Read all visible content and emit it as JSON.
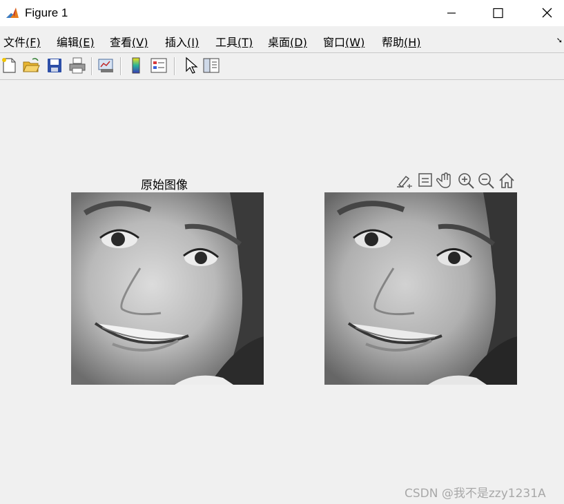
{
  "window": {
    "title": "Figure 1",
    "icon": "matlab-icon",
    "controls": [
      "minimize",
      "maximize",
      "close"
    ]
  },
  "menu": [
    {
      "label": "文件",
      "key": "(F)"
    },
    {
      "label": "编辑",
      "key": "(E)"
    },
    {
      "label": "查看",
      "key": "(V)"
    },
    {
      "label": "插入",
      "key": "(I)"
    },
    {
      "label": "工具",
      "key": "(T)"
    },
    {
      "label": "桌面",
      "key": "(D)"
    },
    {
      "label": "窗口",
      "key": "(W)"
    },
    {
      "label": "帮助",
      "key": "(H)"
    }
  ],
  "toolbar": [
    "new-figure-icon",
    "open-file-icon",
    "save-icon",
    "print-icon",
    "link-plot-icon",
    "insert-colorbar-icon",
    "insert-legend-icon",
    "edit-plot-icon",
    "property-inspector-icon"
  ],
  "axes": [
    {
      "title": "原始图像",
      "image": "grayscale-face-original"
    },
    {
      "title": "",
      "image": "grayscale-face-processed"
    }
  ],
  "axes_toolbar": [
    "brush-icon",
    "data-tips-icon",
    "pan-hand-icon",
    "zoom-in-icon",
    "zoom-out-icon",
    "restore-view-home-icon"
  ],
  "watermark": "CSDN @我不是zzy1231A"
}
